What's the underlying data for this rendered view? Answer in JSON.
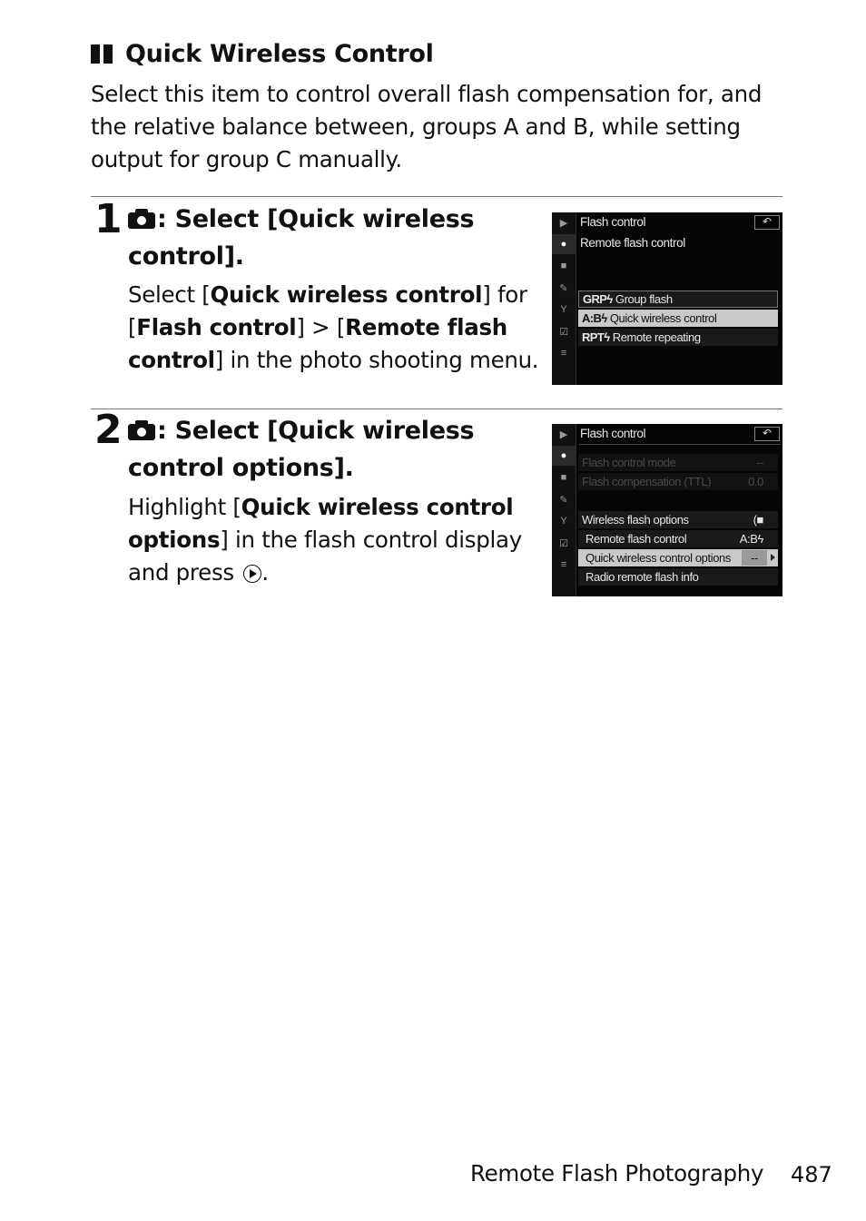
{
  "section": {
    "marker_icon": "double-bar-icon",
    "title": "Quick Wireless Control",
    "intro": "Select this item to control overall flash compensation for, and the relative balance between, groups A and B, while setting output for group C manually."
  },
  "steps": [
    {
      "number": "1",
      "icon": "camera-icon",
      "title": ": Select [Quick wireless control].",
      "body": [
        {
          "t": "Select [",
          "b": false
        },
        {
          "t": "Quick wireless control",
          "b": true
        },
        {
          "t": "] for [",
          "b": false
        },
        {
          "t": "Flash control",
          "b": true
        },
        {
          "t": "] > [",
          "b": false
        },
        {
          "t": "Remote flash control",
          "b": true
        },
        {
          "t": "] in the photo shooting menu.",
          "b": false
        }
      ],
      "screen": {
        "title": "Flash control",
        "back_icon": "return-icon",
        "subtitle": "Remote flash control",
        "options": [
          {
            "prefix": "GRPϟ",
            "label": "Group flash",
            "state": "framed"
          },
          {
            "prefix": "A:Bϟ",
            "label": "Quick wireless control",
            "state": "selected"
          },
          {
            "prefix": "RPTϟ",
            "label": "Remote repeating",
            "state": "normal"
          }
        ]
      }
    },
    {
      "number": "2",
      "icon": "camera-icon",
      "title": ": Select [Quick wireless control options].",
      "body": [
        {
          "t": "Highlight [",
          "b": false
        },
        {
          "t": "Quick wireless control options",
          "b": true
        },
        {
          "t": "] in the flash control display and press ",
          "b": false
        },
        {
          "t": ".",
          "b": false
        }
      ],
      "press_icon": "multi-selector-right-icon",
      "screen": {
        "title": "Flash control",
        "back_icon": "return-icon",
        "rows": [
          {
            "label": "Flash control mode",
            "value": "--",
            "state": "dim"
          },
          {
            "label": "Flash compensation (TTL)",
            "value": "0.0",
            "state": "dim"
          },
          {
            "label": "Wireless flash options",
            "value": "(■",
            "state": "normal"
          },
          {
            "label": "Remote flash control",
            "value": "A:Bϟ",
            "state": "normal"
          },
          {
            "label": "Quick wireless control options",
            "value": "--",
            "state": "selected"
          },
          {
            "label": "Radio remote flash info",
            "value": "",
            "state": "normal"
          }
        ]
      }
    }
  ],
  "menu_rail": [
    "playback-icon",
    "photo-shooting-icon",
    "movie-shooting-icon",
    "custom-settings-icon",
    "setup-icon",
    "retouch-icon",
    "my-menu-icon"
  ],
  "footer": {
    "chapter": "Remote Flash Photography",
    "page": "487"
  }
}
